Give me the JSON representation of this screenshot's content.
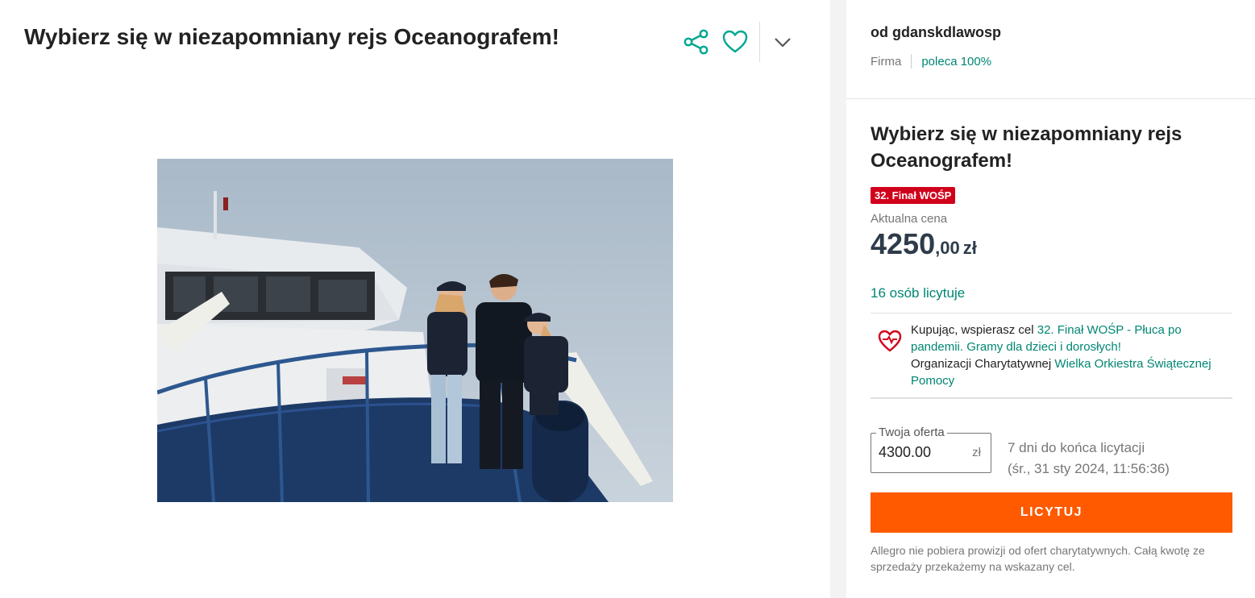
{
  "listing": {
    "title": "Wybierz się w niezapomniany rejs Oceanografem!",
    "photo_icon": "ship-photo"
  },
  "actions": {
    "share_icon": "share-icon",
    "favorite_icon": "heart-icon",
    "expand_icon": "chevron-down-icon"
  },
  "seller": {
    "name": "od gdanskdlawosp",
    "type": "Firma",
    "recommendation": "poleca 100%"
  },
  "offer": {
    "title": "Wybierz się w niezapomniany rejs Oceanografem!",
    "badge": "32. Finał WOŚP",
    "price_label": "Aktualna cena",
    "price_integer": "4250",
    "price_decimal": ",00",
    "price_currency": "zł",
    "bidders": "16 osób licytuje"
  },
  "charity": {
    "icon": "charity-heart-icon",
    "text_prefix": "Kupując, wspierasz cel ",
    "cause_link": "32. Finał WOŚP - Płuca po pandemii. Gramy dla dzieci i dorosłych!",
    "org_prefix": "Organizacji Charytatywnej ",
    "org_link": "Wielka Orkiestra Świątecznej Pomocy"
  },
  "bid": {
    "legend": "Twoja oferta",
    "value": "4300.00",
    "currency": "zł",
    "deadline_line1": "7 dni do końca licytacji",
    "deadline_line2": "(śr., 31 sty 2024, 11:56:36)",
    "button_label": "LICYTUJ",
    "fine_print": "Allegro nie pobiera prowizji od ofert charytatywnych. Całą kwotę ze sprzedaży przekażemy na wskazany cel."
  },
  "colors": {
    "accent_green": "#008673",
    "action_teal": "#00a790",
    "bid_orange": "#ff5a00",
    "badge_red": "#d0021b"
  }
}
